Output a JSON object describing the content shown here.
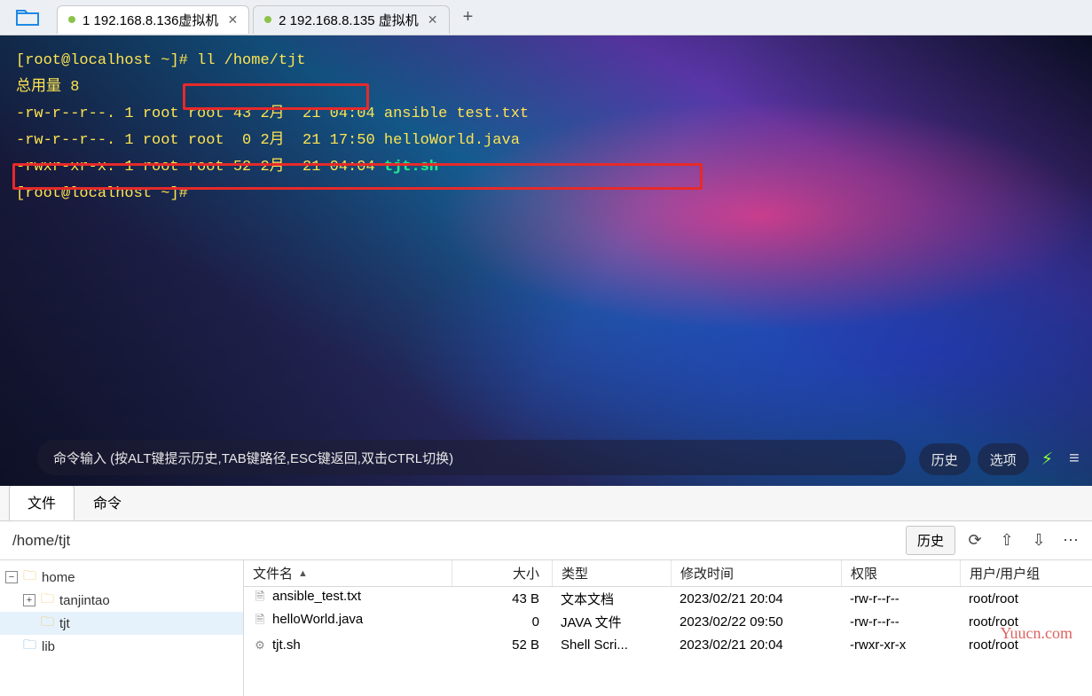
{
  "tabs": [
    {
      "label": "1 192.168.8.136虚拟机",
      "active": true
    },
    {
      "label": "2 192.168.8.135 虚拟机",
      "active": false
    }
  ],
  "terminal": {
    "prompt_open": "[",
    "prompt_user": "root@localhost",
    "prompt_path": " ~",
    "prompt_close": "]# ",
    "command": "ll /home/tjt",
    "total_line": "总用量 8",
    "rows": [
      {
        "text": "-rw-r--r--. 1 root root 43 2月  21 04:04 ansible test.txt"
      },
      {
        "text": "-rw-r--r--. 1 root root  0 2月  21 17:50 helloWorld.java"
      },
      {
        "perm": "-rwxr-xr-x. 1 root root 52 2月  21 04:04 ",
        "file": "tjt.sh"
      }
    ],
    "prompt2_open": "[",
    "prompt2_user": "root@localhost",
    "prompt2_path": " ~",
    "prompt2_close": "]# ",
    "cmdbar_placeholder": "命令输入 (按ALT键提示历史,TAB键路径,ESC键返回,双击CTRL切换)",
    "btn_history": "历史",
    "btn_options": "选项"
  },
  "panel": {
    "tab_files": "文件",
    "tab_cmd": "命令",
    "path": "/home/tjt",
    "history_btn": "历史",
    "tree": {
      "root": "home",
      "children": [
        {
          "name": "tanjintao"
        },
        {
          "name": "tjt",
          "selected": true
        }
      ],
      "sibling": "lib"
    },
    "columns": {
      "name": "文件名",
      "size": "大小",
      "type": "类型",
      "time": "修改时间",
      "perm": "权限",
      "user": "用户/用户组"
    },
    "files": [
      {
        "icon": "doc",
        "name": "ansible_test.txt",
        "size": "43 B",
        "type": "文本文档",
        "time": "2023/02/21 20:04",
        "perm": "-rw-r--r--",
        "user": "root/root"
      },
      {
        "icon": "doc",
        "name": "helloWorld.java",
        "size": "0",
        "type": "JAVA 文件",
        "time": "2023/02/22 09:50",
        "perm": "-rw-r--r--",
        "user": "root/root"
      },
      {
        "icon": "gear",
        "name": "tjt.sh",
        "size": "52 B",
        "type": "Shell Scri...",
        "time": "2023/02/21 20:04",
        "perm": "-rwxr-xr-x",
        "user": "root/root"
      }
    ]
  },
  "watermark": "Yuucn.com"
}
